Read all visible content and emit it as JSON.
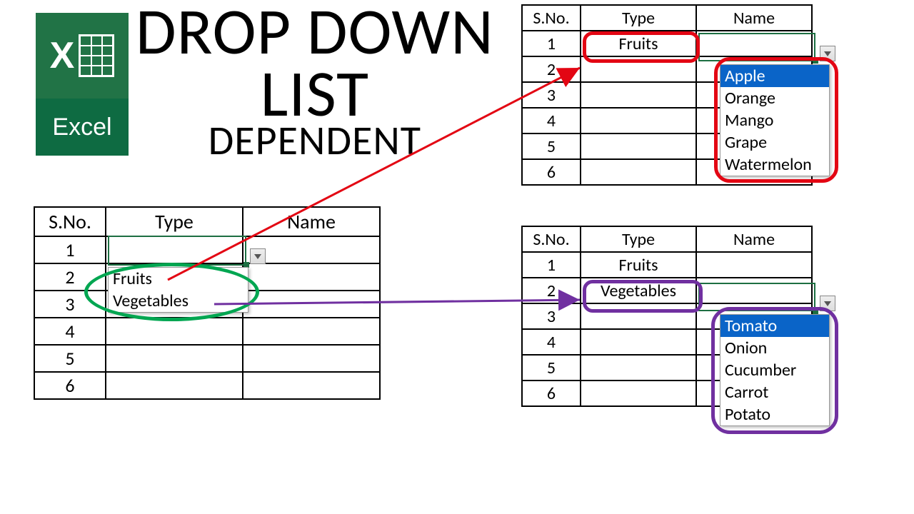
{
  "logo": {
    "x": "X",
    "label": "Excel"
  },
  "title": {
    "l1": "DROP DOWN",
    "l2": "LIST",
    "l3": "DEPENDENT"
  },
  "left_table": {
    "headers": [
      "S.No.",
      "Type",
      "Name"
    ],
    "rows": [
      {
        "sno": "1",
        "type": "",
        "name": ""
      },
      {
        "sno": "2",
        "type": "",
        "name": ""
      },
      {
        "sno": "3",
        "type": "",
        "name": ""
      },
      {
        "sno": "4",
        "type": "",
        "name": ""
      },
      {
        "sno": "5",
        "type": "",
        "name": ""
      },
      {
        "sno": "6",
        "type": "",
        "name": ""
      }
    ],
    "type_dropdown": {
      "options": [
        "Fruits",
        "Vegetables"
      ]
    }
  },
  "top_right_table": {
    "headers": [
      "S.No.",
      "Type",
      "Name"
    ],
    "rows": [
      {
        "sno": "1",
        "type": "Fruits",
        "name": ""
      },
      {
        "sno": "2",
        "type": "",
        "name": ""
      },
      {
        "sno": "3",
        "type": "",
        "name": ""
      },
      {
        "sno": "4",
        "type": "",
        "name": ""
      },
      {
        "sno": "5",
        "type": "",
        "name": ""
      },
      {
        "sno": "6",
        "type": "",
        "name": ""
      }
    ],
    "name_dropdown": {
      "selected": "Apple",
      "options": [
        "Apple",
        "Orange",
        "Mango",
        "Grape",
        "Watermelon"
      ]
    }
  },
  "bottom_right_table": {
    "headers": [
      "S.No.",
      "Type",
      "Name"
    ],
    "rows": [
      {
        "sno": "1",
        "type": "Fruits",
        "name": ""
      },
      {
        "sno": "2",
        "type": "Vegetables",
        "name": ""
      },
      {
        "sno": "3",
        "type": "",
        "name": ""
      },
      {
        "sno": "4",
        "type": "",
        "name": ""
      },
      {
        "sno": "5",
        "type": "",
        "name": ""
      },
      {
        "sno": "6",
        "type": "",
        "name": ""
      }
    ],
    "name_dropdown": {
      "selected": "Tomato",
      "options": [
        "Tomato",
        "Onion",
        "Cucumber",
        "Carrot",
        "Potato"
      ]
    }
  },
  "colors": {
    "excel_green": "#217346",
    "red": "#e30613",
    "purple": "#7030a0",
    "green": "#00a651",
    "sel_blue": "#0a64c8"
  }
}
